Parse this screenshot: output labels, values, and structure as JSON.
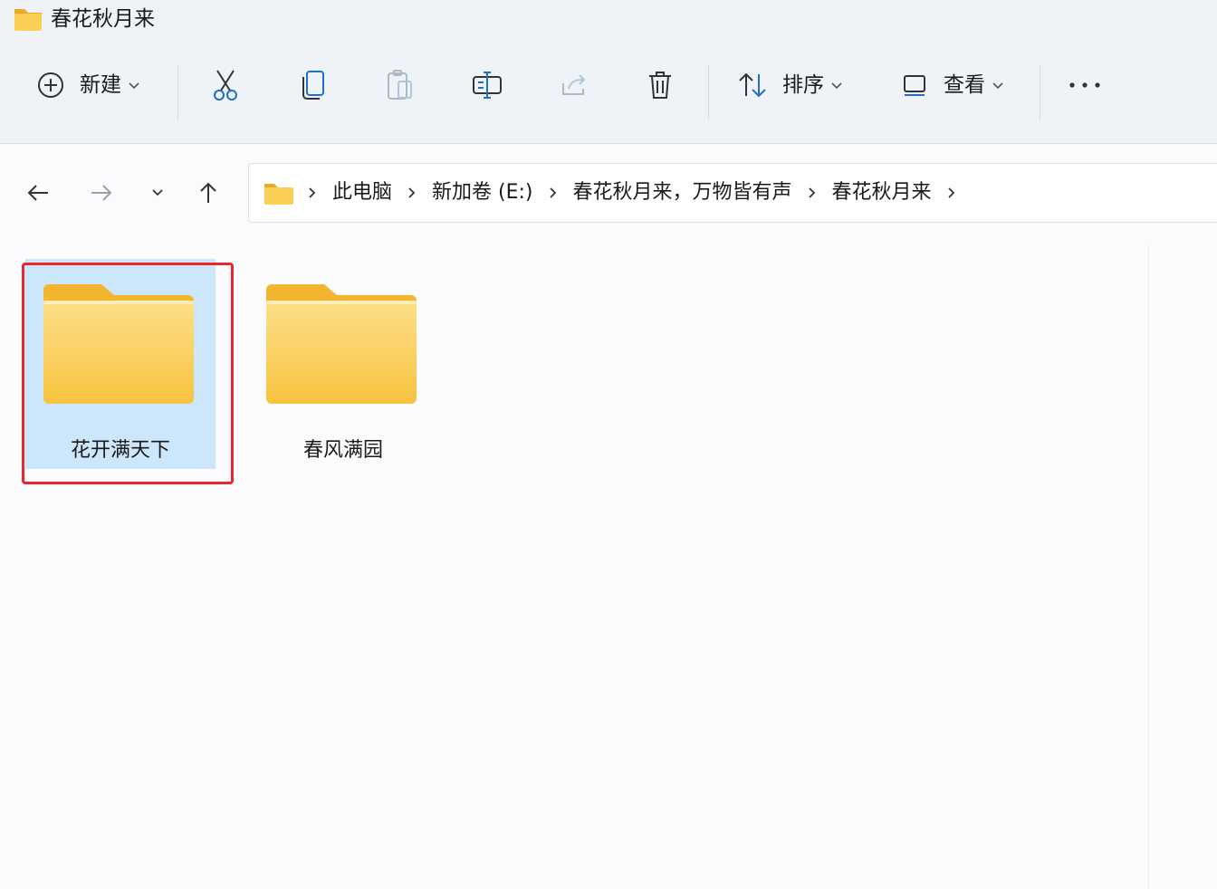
{
  "window": {
    "title": "春花秋月来",
    "title_icon": "folder-icon"
  },
  "toolbar": {
    "new_label": "新建",
    "sort_label": "排序",
    "view_label": "查看",
    "icons": [
      "plus-circle-icon",
      "cut-icon",
      "copy-icon",
      "paste-icon",
      "rename-icon",
      "share-icon",
      "delete-icon",
      "sort-icon",
      "view-icon",
      "more-icon"
    ]
  },
  "nav": {
    "icons": [
      "back-arrow-icon",
      "forward-arrow-icon",
      "recent-chevron-icon",
      "up-arrow-icon"
    ]
  },
  "breadcrumb": {
    "items": [
      "此电脑",
      "新加卷 (E:)",
      "春花秋月来，万物皆有声",
      "春花秋月来"
    ]
  },
  "files": [
    {
      "name": "花开满天下",
      "type": "folder",
      "selected": true
    },
    {
      "name": "春风满园",
      "type": "folder",
      "selected": false
    }
  ],
  "colors": {
    "accent_selection": "#cce6fb",
    "highlight_box": "#e8262b",
    "folder_yellow": "#f8c94a",
    "chrome_bg": "#eff2f7"
  }
}
